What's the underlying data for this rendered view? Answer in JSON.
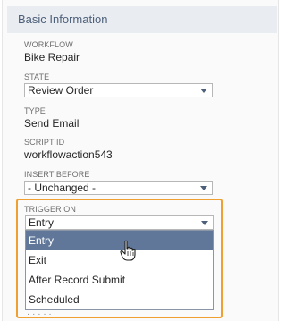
{
  "section": {
    "title": "Basic Information"
  },
  "fields": {
    "workflow": {
      "label": "WORKFLOW",
      "value": "Bike Repair"
    },
    "state": {
      "label": "STATE",
      "value": "Review Order"
    },
    "type": {
      "label": "TYPE",
      "value": "Send Email"
    },
    "script_id": {
      "label": "SCRIPT ID",
      "value": "workflowaction543"
    },
    "insert_before": {
      "label": "INSERT BEFORE",
      "value": "- Unchanged -"
    },
    "trigger_on": {
      "label": "TRIGGER ON",
      "value": "Entry"
    }
  },
  "dropdown": {
    "options": [
      "Entry",
      "Exit",
      "After Record Submit",
      "Scheduled"
    ],
    "selected_index": 0
  },
  "icons": {
    "dropdown_arrow": "chevron-down-icon",
    "cursor": "hand-pointer-icon"
  },
  "colors": {
    "header_bg": "#e9edf2",
    "header_text": "#4d5f79",
    "selected_option_bg": "#607799",
    "highlight_border": "#f0a030"
  }
}
